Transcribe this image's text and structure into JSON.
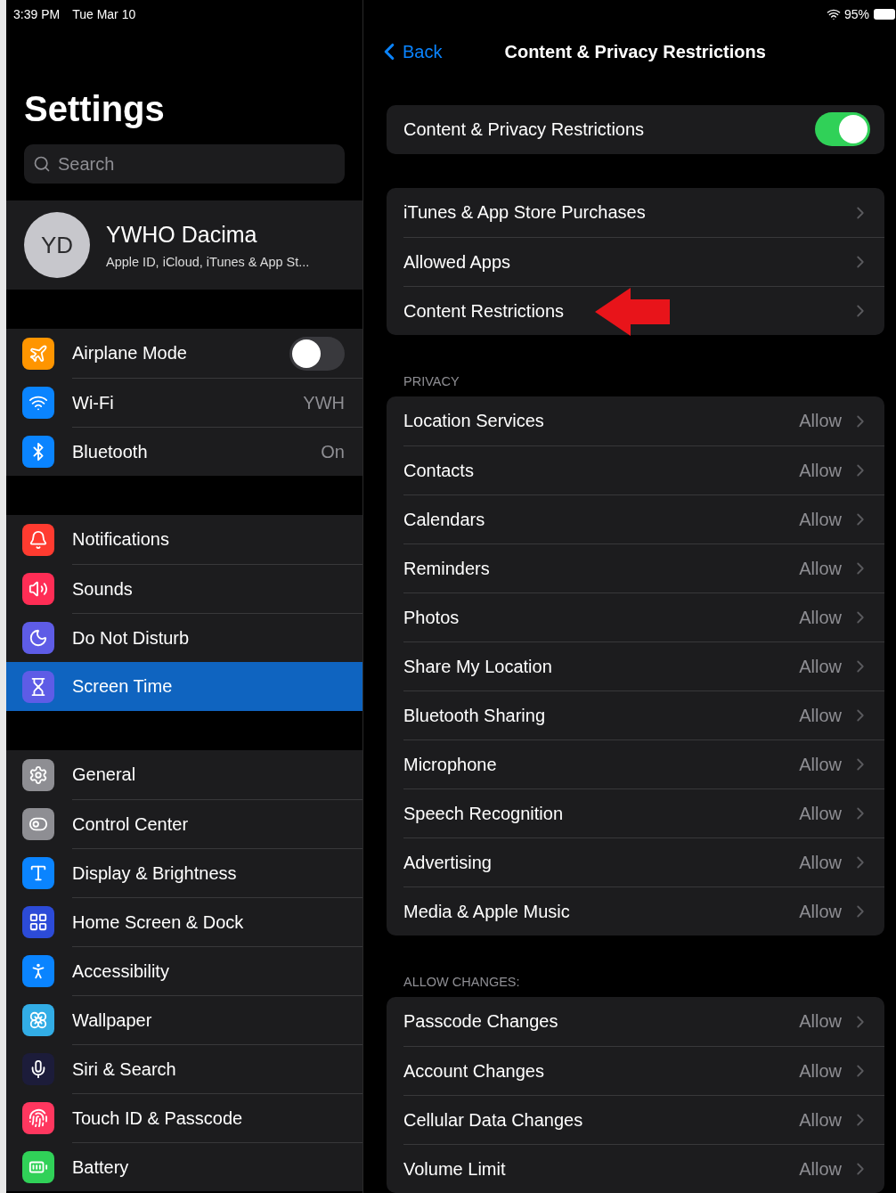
{
  "status_bar": {
    "time": "3:39 PM",
    "date": "Tue Mar 10",
    "battery": "95%"
  },
  "sidebar": {
    "title": "Settings",
    "search": {
      "placeholder": "Search"
    },
    "profile": {
      "initials": "YD",
      "name": "YWHO Dacima",
      "subtitle": "Apple ID, iCloud, iTunes & App St..."
    },
    "groups": [
      [
        {
          "label": "Airplane Mode",
          "kind": "toggle",
          "on": false,
          "color": "#ff9500",
          "selected": false
        },
        {
          "label": "Wi-Fi",
          "kind": "value",
          "value": "YWH",
          "color": "#0a84ff",
          "selected": false
        },
        {
          "label": "Bluetooth",
          "kind": "value",
          "value": "On",
          "color": "#0a84ff",
          "selected": false
        }
      ],
      [
        {
          "label": "Notifications",
          "kind": "plain",
          "color": "#ff3b30",
          "selected": false
        },
        {
          "label": "Sounds",
          "kind": "plain",
          "color": "#ff2d55",
          "selected": false
        },
        {
          "label": "Do Not Disturb",
          "kind": "plain",
          "color": "#5e5ce6",
          "selected": false
        },
        {
          "label": "Screen Time",
          "kind": "plain",
          "color": "#5e5ce6",
          "selected": true
        }
      ],
      [
        {
          "label": "General",
          "kind": "plain",
          "color": "#8e8e93",
          "selected": false
        },
        {
          "label": "Control Center",
          "kind": "plain",
          "color": "#8e8e93",
          "selected": false
        },
        {
          "label": "Display & Brightness",
          "kind": "plain",
          "color": "#0a84ff",
          "selected": false
        },
        {
          "label": "Home Screen & Dock",
          "kind": "plain",
          "color": "#2c4bd8",
          "selected": false
        },
        {
          "label": "Accessibility",
          "kind": "plain",
          "color": "#0a84ff",
          "selected": false
        },
        {
          "label": "Wallpaper",
          "kind": "plain",
          "color": "#32ade6",
          "selected": false
        },
        {
          "label": "Siri & Search",
          "kind": "plain",
          "color": "#1c1c3a",
          "selected": false
        },
        {
          "label": "Touch ID & Passcode",
          "kind": "plain",
          "color": "#ff375f",
          "selected": false
        },
        {
          "label": "Battery",
          "kind": "plain",
          "color": "#30d158",
          "selected": false
        }
      ]
    ]
  },
  "detail": {
    "back": "Back",
    "title": "Content & Privacy Restrictions",
    "sections": [
      {
        "rows": [
          {
            "label": "Content & Privacy Restrictions",
            "kind": "toggle",
            "on": true
          }
        ]
      },
      {
        "rows": [
          {
            "label": "iTunes & App Store Purchases",
            "kind": "link"
          },
          {
            "label": "Allowed Apps",
            "kind": "link"
          },
          {
            "label": "Content Restrictions",
            "kind": "link",
            "arrow": true
          }
        ]
      },
      {
        "header": "PRIVACY",
        "rows": [
          {
            "label": "Location Services",
            "kind": "link",
            "value": "Allow"
          },
          {
            "label": "Contacts",
            "kind": "link",
            "value": "Allow"
          },
          {
            "label": "Calendars",
            "kind": "link",
            "value": "Allow"
          },
          {
            "label": "Reminders",
            "kind": "link",
            "value": "Allow"
          },
          {
            "label": "Photos",
            "kind": "link",
            "value": "Allow"
          },
          {
            "label": "Share My Location",
            "kind": "link",
            "value": "Allow"
          },
          {
            "label": "Bluetooth Sharing",
            "kind": "link",
            "value": "Allow"
          },
          {
            "label": "Microphone",
            "kind": "link",
            "value": "Allow"
          },
          {
            "label": "Speech Recognition",
            "kind": "link",
            "value": "Allow"
          },
          {
            "label": "Advertising",
            "kind": "link",
            "value": "Allow"
          },
          {
            "label": "Media & Apple Music",
            "kind": "link",
            "value": "Allow"
          }
        ]
      },
      {
        "header": "ALLOW CHANGES:",
        "rows": [
          {
            "label": "Passcode Changes",
            "kind": "link",
            "value": "Allow"
          },
          {
            "label": "Account Changes",
            "kind": "link",
            "value": "Allow"
          },
          {
            "label": "Cellular Data Changes",
            "kind": "link",
            "value": "Allow"
          },
          {
            "label": "Volume Limit",
            "kind": "link",
            "value": "Allow"
          }
        ]
      }
    ]
  }
}
